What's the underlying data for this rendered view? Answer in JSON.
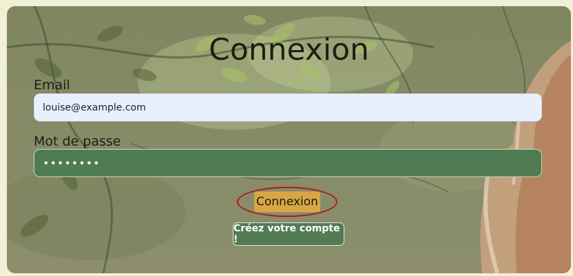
{
  "form": {
    "title": "Connexion",
    "email_label": "Email",
    "email_value": "louise@example.com",
    "password_label": "Mot de passe",
    "password_value": "••••••••",
    "login_button": "Connexion",
    "create_account_button": "Créez votre compte !"
  },
  "colors": {
    "page_background": "#f1efd5",
    "email_field": "#e8f0fe",
    "password_field": "#4f7b52",
    "login_button": "#d6a845",
    "login_highlight_ring": "#b3151c",
    "create_account_button": "#527b56"
  }
}
